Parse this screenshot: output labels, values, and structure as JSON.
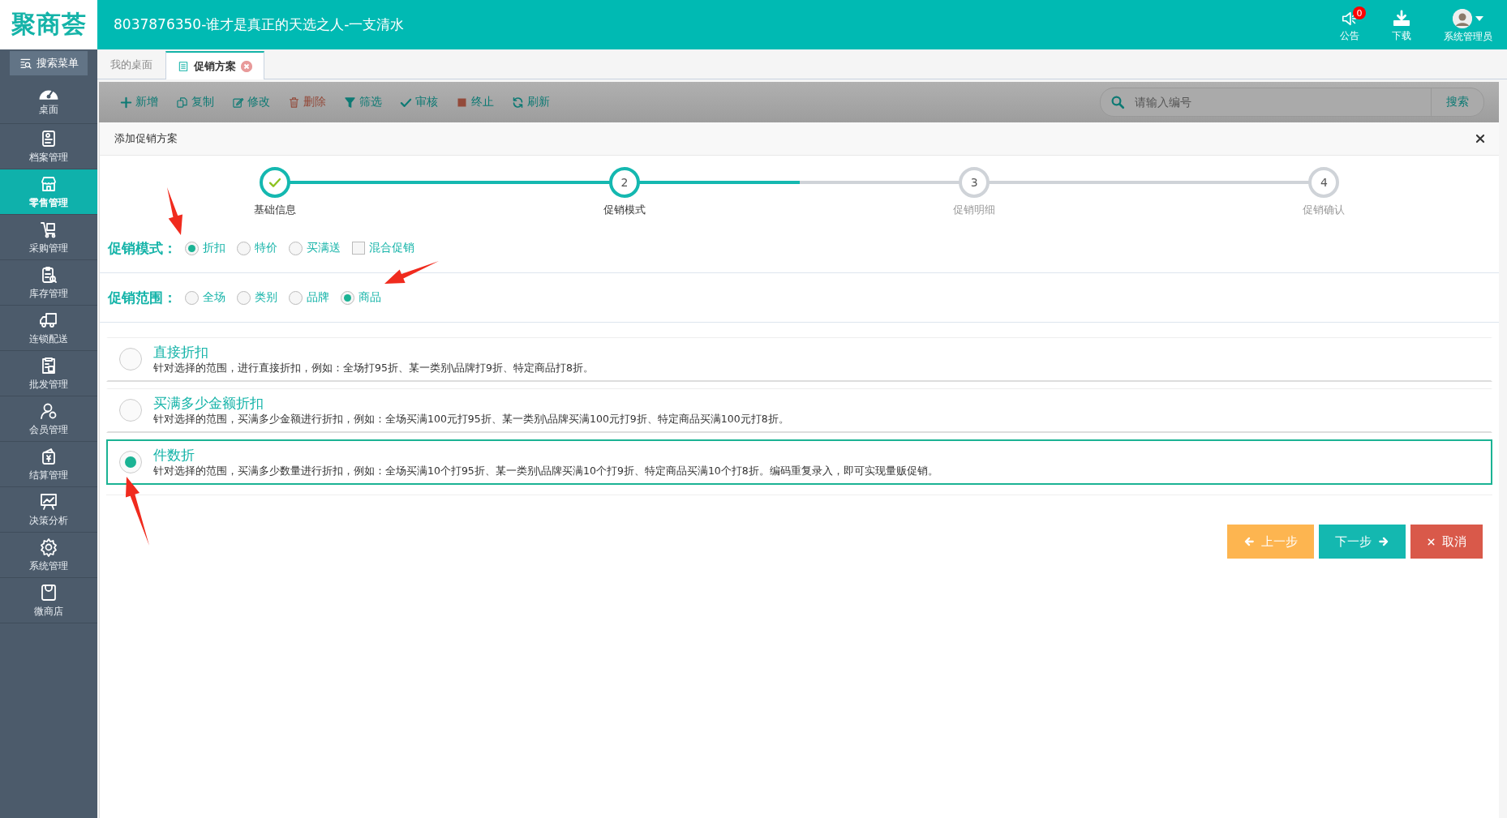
{
  "header": {
    "logo": "聚商荟",
    "title": "8037876350-谁才是真正的天选之人-一支清水",
    "actions": [
      {
        "label": "公告",
        "badge": "0"
      },
      {
        "label": "下载"
      },
      {
        "label": "系统管理员"
      }
    ]
  },
  "sidebar": {
    "search_button": "搜索菜单",
    "items": [
      {
        "label": "桌面",
        "selected": false
      },
      {
        "label": "档案管理",
        "selected": false
      },
      {
        "label": "零售管理",
        "selected": true
      },
      {
        "label": "采购管理",
        "selected": false
      },
      {
        "label": "库存管理",
        "selected": false
      },
      {
        "label": "连锁配送",
        "selected": false
      },
      {
        "label": "批发管理",
        "selected": false
      },
      {
        "label": "会员管理",
        "selected": false
      },
      {
        "label": "结算管理",
        "selected": false
      },
      {
        "label": "决策分析",
        "selected": false
      },
      {
        "label": "系统管理",
        "selected": false
      },
      {
        "label": "微商店",
        "selected": false
      }
    ]
  },
  "tabs": [
    {
      "label": "我的桌面",
      "selected": false
    },
    {
      "label": "促销方案",
      "selected": true
    }
  ],
  "toolbar": {
    "buttons": [
      {
        "label": "新增"
      },
      {
        "label": "复制"
      },
      {
        "label": "修改"
      },
      {
        "label": "删除"
      },
      {
        "label": "筛选"
      },
      {
        "label": "审核"
      },
      {
        "label": "终止"
      },
      {
        "label": "刷新"
      }
    ],
    "search_placeholder": "请输入编号",
    "search_button": "搜索"
  },
  "dialog": {
    "title": "添加促销方案",
    "steps": [
      {
        "label": "基础信息",
        "completed": true,
        "current": false
      },
      {
        "number": "2",
        "label": "促销模式",
        "completed": false,
        "current": true
      },
      {
        "number": "3",
        "label": "促销明细",
        "completed": false,
        "current": false
      },
      {
        "number": "4",
        "label": "促销确认",
        "completed": false,
        "current": false
      }
    ],
    "mode": {
      "label": "促销模式：",
      "options": [
        {
          "kind": "radio",
          "label": "折扣",
          "selected": true
        },
        {
          "kind": "radio",
          "label": "特价",
          "selected": false
        },
        {
          "kind": "radio",
          "label": "买满送",
          "selected": false
        },
        {
          "kind": "checkbox",
          "label": "混合促销",
          "checked": false
        }
      ]
    },
    "scope": {
      "label": "促销范围：",
      "options": [
        {
          "kind": "radio",
          "label": "全场",
          "selected": false
        },
        {
          "kind": "radio",
          "label": "类别",
          "selected": false
        },
        {
          "kind": "radio",
          "label": "品牌",
          "selected": false
        },
        {
          "kind": "radio",
          "label": "商品",
          "selected": true
        }
      ]
    },
    "choices": [
      {
        "title": "直接折扣",
        "description": "针对选择的范围，进行直接折扣，例如：全场打95折、某一类别\\品牌打9折、特定商品打8折。",
        "selected": false
      },
      {
        "title": "买满多少金额折扣",
        "description": "针对选择的范围，买满多少金额进行折扣，例如：全场买满100元打95折、某一类别\\品牌买满100元打9折、特定商品买满100元打8折。",
        "selected": false
      },
      {
        "title": "件数折",
        "description": "针对选择的范围，买满多少数量进行折扣，例如：全场买满10个打95折、某一类别\\品牌买满10个打9折、特定商品买满10个打8折。编码重复录入，即可实现量贩促销。",
        "selected": true
      }
    ],
    "buttons": [
      {
        "kind": "prev",
        "label": "上一步"
      },
      {
        "kind": "next",
        "label": "下一步"
      },
      {
        "kind": "cancel",
        "label": "取消"
      }
    ]
  }
}
